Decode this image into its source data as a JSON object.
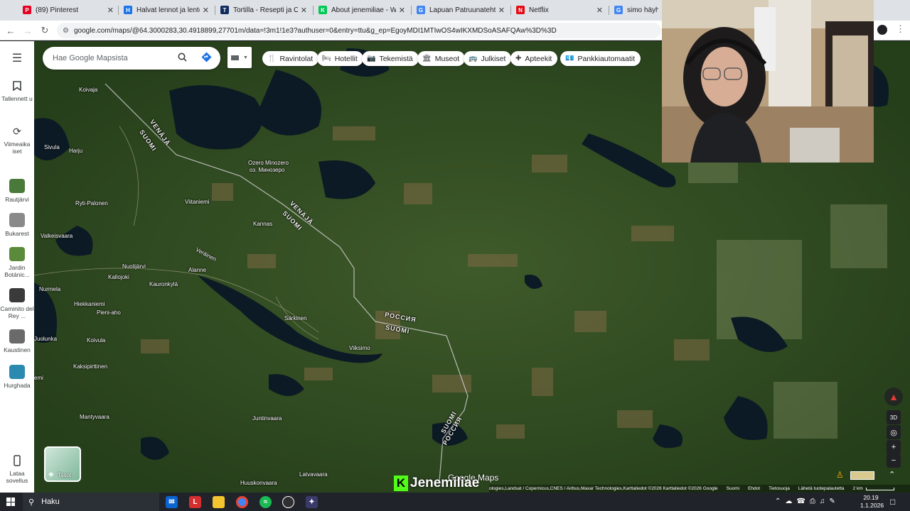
{
  "browser": {
    "tabs": [
      {
        "title": "(89) Pinterest",
        "color": "#e60023",
        "glyph": "P"
      },
      {
        "title": "Halvat lennot ja lentolipu",
        "color": "#1a73e8",
        "glyph": "H"
      },
      {
        "title": "Tortilla - Resepti ja Ohje",
        "color": "#0f2c5f",
        "glyph": "T"
      },
      {
        "title": "About jenemiliae - Watch",
        "color": "#00c853",
        "glyph": "K"
      },
      {
        "title": "Lapuan Patruunatehtaan",
        "color": "#4285f4",
        "glyph": "G"
      },
      {
        "title": "Netflix",
        "color": "#e50914",
        "glyph": "N"
      },
      {
        "title": "simo häyhä - G",
        "color": "#4285f4",
        "glyph": "G"
      }
    ],
    "url": "google.com/maps/@64.3000283,30.4918899,27701m/data=!3m1!1e3?authuser=0&entry=ttu&g_ep=EgoyMDI1MTIwOS4wIKXMDSoASAFQAw%3D%3D"
  },
  "sidebar": {
    "menu_icon": "menu-icon",
    "saved_label": "Tallennett u",
    "recent_label": "Viimeaika iset",
    "recents": [
      {
        "label": "Rautjärvi",
        "color": "#4a7a3a"
      },
      {
        "label": "Bukarest",
        "color": "#8a8a8a"
      },
      {
        "label": "Jardin Botánic...",
        "color": "#5a8a3a"
      },
      {
        "label": "Caminito del Rey ...",
        "color": "#3a3a3a"
      },
      {
        "label": "Kaustinen",
        "color": "#6a6a6a"
      },
      {
        "label": "Hurghada",
        "color": "#2a8ab0"
      }
    ],
    "download_label": "Lataa sovellus"
  },
  "search": {
    "placeholder": "Hae Google Mapsista"
  },
  "chips": [
    {
      "label": "Ravintolat",
      "icon": "fork-knife-icon",
      "glyph": "🍴"
    },
    {
      "label": "Hotellit",
      "icon": "bed-icon",
      "glyph": "🛏"
    },
    {
      "label": "Tekemistä",
      "icon": "camera-icon",
      "glyph": "📷"
    },
    {
      "label": "Museot",
      "icon": "museum-icon",
      "glyph": "🏛"
    },
    {
      "label": "Julkiset",
      "icon": "bus-icon",
      "glyph": "🚌"
    },
    {
      "label": "Apteekit",
      "icon": "pharmacy-icon",
      "glyph": "✚"
    },
    {
      "label": "Pankkiautomaatit",
      "icon": "atm-icon",
      "glyph": "💶"
    }
  ],
  "map_labels": [
    {
      "text": "Koivaja",
      "kind": "place"
    },
    {
      "text": "Sivula",
      "kind": "place"
    },
    {
      "text": "Harju",
      "kind": "place"
    },
    {
      "text": "Ozero Minozero",
      "kind": "place"
    },
    {
      "text": "оз. Минозеро",
      "kind": "place"
    },
    {
      "text": "Ryti-Palonen",
      "kind": "place"
    },
    {
      "text": "Viitaniemi",
      "kind": "place"
    },
    {
      "text": "Valkeisvaara",
      "kind": "place"
    },
    {
      "text": "Kannas",
      "kind": "place"
    },
    {
      "text": "Nuolijärvi",
      "kind": "place"
    },
    {
      "text": "Kallojoki",
      "kind": "place"
    },
    {
      "text": "Alanne",
      "kind": "place"
    },
    {
      "text": "Veräinen",
      "kind": "place"
    },
    {
      "text": "Kauronkylä",
      "kind": "place"
    },
    {
      "text": "Nurmela",
      "kind": "place"
    },
    {
      "text": "Hiekkaniemi",
      "kind": "place"
    },
    {
      "text": "Pieni-aho",
      "kind": "place"
    },
    {
      "text": "Särkinen",
      "kind": "place"
    },
    {
      "text": "Juolunka",
      "kind": "place"
    },
    {
      "text": "Koivula",
      "kind": "place"
    },
    {
      "text": "Viiksimo",
      "kind": "place"
    },
    {
      "text": "Kaksipirttinen",
      "kind": "place"
    },
    {
      "text": "Mantyvaara",
      "kind": "place"
    },
    {
      "text": "Juntinvaara",
      "kind": "place"
    },
    {
      "text": "Huuskonvaara",
      "kind": "place"
    },
    {
      "text": "Latvavaara",
      "kind": "place"
    },
    {
      "text": "emi",
      "kind": "place"
    },
    {
      "text": "VENÄJÄ",
      "kind": "border"
    },
    {
      "text": "SUOMI",
      "kind": "border"
    },
    {
      "text": "VENÄJÄ",
      "kind": "border"
    },
    {
      "text": "SUOMI",
      "kind": "border"
    },
    {
      "text": "РОССИЯ",
      "kind": "border"
    },
    {
      "text": "SUOMI",
      "kind": "border"
    },
    {
      "text": "SUOMI",
      "kind": "border"
    },
    {
      "text": "РОССИЯ",
      "kind": "border"
    }
  ],
  "layers": {
    "label": "Tasot"
  },
  "attribution": {
    "logo": "Google Maps",
    "text": "ologies,Landsat / Copernicus,CNES / Airbus,Maxar Technologies,Karttatiedot ©2026 Karttatiedot ©2026 Google",
    "links": [
      "Suomi",
      "Ehdot",
      "Tietosuoja",
      "Lähetä tuotepalautetta"
    ],
    "scale": "2 km"
  },
  "watermark": {
    "text": "Jenemiliae",
    "logo": "K"
  },
  "taskbar": {
    "search_placeholder": "Haku",
    "time": "20.19",
    "date": "1.1.2026"
  }
}
